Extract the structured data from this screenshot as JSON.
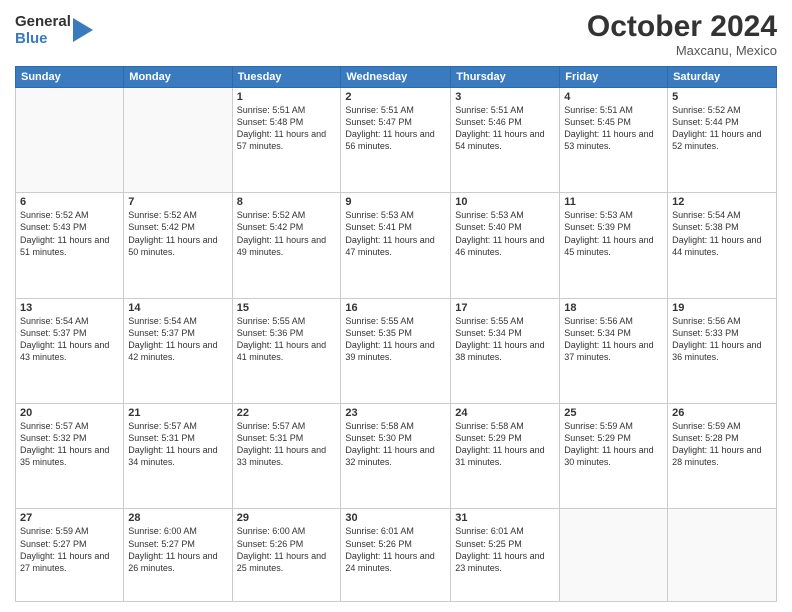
{
  "header": {
    "logo_general": "General",
    "logo_blue": "Blue",
    "month_title": "October 2024",
    "location": "Maxcanu, Mexico"
  },
  "days_of_week": [
    "Sunday",
    "Monday",
    "Tuesday",
    "Wednesday",
    "Thursday",
    "Friday",
    "Saturday"
  ],
  "weeks": [
    [
      {
        "day": "",
        "info": ""
      },
      {
        "day": "",
        "info": ""
      },
      {
        "day": "1",
        "info": "Sunrise: 5:51 AM\nSunset: 5:48 PM\nDaylight: 11 hours and 57 minutes."
      },
      {
        "day": "2",
        "info": "Sunrise: 5:51 AM\nSunset: 5:47 PM\nDaylight: 11 hours and 56 minutes."
      },
      {
        "day": "3",
        "info": "Sunrise: 5:51 AM\nSunset: 5:46 PM\nDaylight: 11 hours and 54 minutes."
      },
      {
        "day": "4",
        "info": "Sunrise: 5:51 AM\nSunset: 5:45 PM\nDaylight: 11 hours and 53 minutes."
      },
      {
        "day": "5",
        "info": "Sunrise: 5:52 AM\nSunset: 5:44 PM\nDaylight: 11 hours and 52 minutes."
      }
    ],
    [
      {
        "day": "6",
        "info": "Sunrise: 5:52 AM\nSunset: 5:43 PM\nDaylight: 11 hours and 51 minutes."
      },
      {
        "day": "7",
        "info": "Sunrise: 5:52 AM\nSunset: 5:42 PM\nDaylight: 11 hours and 50 minutes."
      },
      {
        "day": "8",
        "info": "Sunrise: 5:52 AM\nSunset: 5:42 PM\nDaylight: 11 hours and 49 minutes."
      },
      {
        "day": "9",
        "info": "Sunrise: 5:53 AM\nSunset: 5:41 PM\nDaylight: 11 hours and 47 minutes."
      },
      {
        "day": "10",
        "info": "Sunrise: 5:53 AM\nSunset: 5:40 PM\nDaylight: 11 hours and 46 minutes."
      },
      {
        "day": "11",
        "info": "Sunrise: 5:53 AM\nSunset: 5:39 PM\nDaylight: 11 hours and 45 minutes."
      },
      {
        "day": "12",
        "info": "Sunrise: 5:54 AM\nSunset: 5:38 PM\nDaylight: 11 hours and 44 minutes."
      }
    ],
    [
      {
        "day": "13",
        "info": "Sunrise: 5:54 AM\nSunset: 5:37 PM\nDaylight: 11 hours and 43 minutes."
      },
      {
        "day": "14",
        "info": "Sunrise: 5:54 AM\nSunset: 5:37 PM\nDaylight: 11 hours and 42 minutes."
      },
      {
        "day": "15",
        "info": "Sunrise: 5:55 AM\nSunset: 5:36 PM\nDaylight: 11 hours and 41 minutes."
      },
      {
        "day": "16",
        "info": "Sunrise: 5:55 AM\nSunset: 5:35 PM\nDaylight: 11 hours and 39 minutes."
      },
      {
        "day": "17",
        "info": "Sunrise: 5:55 AM\nSunset: 5:34 PM\nDaylight: 11 hours and 38 minutes."
      },
      {
        "day": "18",
        "info": "Sunrise: 5:56 AM\nSunset: 5:34 PM\nDaylight: 11 hours and 37 minutes."
      },
      {
        "day": "19",
        "info": "Sunrise: 5:56 AM\nSunset: 5:33 PM\nDaylight: 11 hours and 36 minutes."
      }
    ],
    [
      {
        "day": "20",
        "info": "Sunrise: 5:57 AM\nSunset: 5:32 PM\nDaylight: 11 hours and 35 minutes."
      },
      {
        "day": "21",
        "info": "Sunrise: 5:57 AM\nSunset: 5:31 PM\nDaylight: 11 hours and 34 minutes."
      },
      {
        "day": "22",
        "info": "Sunrise: 5:57 AM\nSunset: 5:31 PM\nDaylight: 11 hours and 33 minutes."
      },
      {
        "day": "23",
        "info": "Sunrise: 5:58 AM\nSunset: 5:30 PM\nDaylight: 11 hours and 32 minutes."
      },
      {
        "day": "24",
        "info": "Sunrise: 5:58 AM\nSunset: 5:29 PM\nDaylight: 11 hours and 31 minutes."
      },
      {
        "day": "25",
        "info": "Sunrise: 5:59 AM\nSunset: 5:29 PM\nDaylight: 11 hours and 30 minutes."
      },
      {
        "day": "26",
        "info": "Sunrise: 5:59 AM\nSunset: 5:28 PM\nDaylight: 11 hours and 28 minutes."
      }
    ],
    [
      {
        "day": "27",
        "info": "Sunrise: 5:59 AM\nSunset: 5:27 PM\nDaylight: 11 hours and 27 minutes."
      },
      {
        "day": "28",
        "info": "Sunrise: 6:00 AM\nSunset: 5:27 PM\nDaylight: 11 hours and 26 minutes."
      },
      {
        "day": "29",
        "info": "Sunrise: 6:00 AM\nSunset: 5:26 PM\nDaylight: 11 hours and 25 minutes."
      },
      {
        "day": "30",
        "info": "Sunrise: 6:01 AM\nSunset: 5:26 PM\nDaylight: 11 hours and 24 minutes."
      },
      {
        "day": "31",
        "info": "Sunrise: 6:01 AM\nSunset: 5:25 PM\nDaylight: 11 hours and 23 minutes."
      },
      {
        "day": "",
        "info": ""
      },
      {
        "day": "",
        "info": ""
      }
    ]
  ]
}
